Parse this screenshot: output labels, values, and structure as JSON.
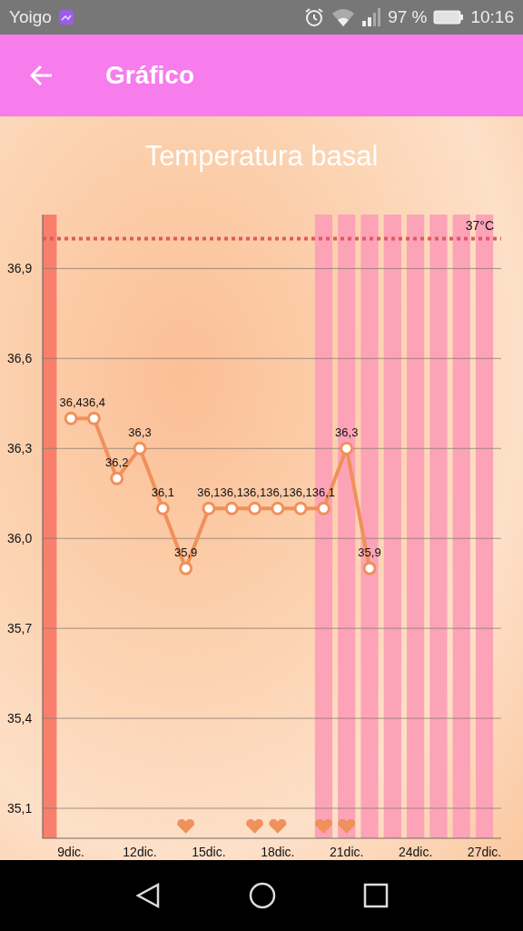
{
  "status_bar": {
    "carrier": "Yoigo",
    "battery": "97 %",
    "time": "10:16"
  },
  "app_bar": {
    "title": "Gráfico"
  },
  "chart_data": {
    "type": "line",
    "title": "Temperatura basal",
    "x": [
      9,
      10,
      11,
      12,
      13,
      14,
      15,
      16,
      17,
      18,
      19,
      20,
      21,
      22
    ],
    "series": [
      {
        "color": "#f0905a",
        "marker": "circle",
        "values": [
          36.4,
          36.4,
          36.2,
          36.3,
          36.1,
          35.9,
          36.1,
          36.1,
          36.1,
          36.1,
          36.1,
          36.1,
          36.3,
          35.9
        ]
      },
      {
        "type": "scatter",
        "color": "#f0905a",
        "values": [
          null,
          null,
          null,
          null,
          null,
          35.04,
          null,
          null,
          35.04,
          35.04,
          null,
          35.04,
          35.04,
          null
        ]
      }
    ],
    "value_labels": [
      "36,4",
      "36,4",
      "36,2",
      "36,3",
      "36,1",
      "35,9",
      "36,1",
      "36,1",
      "36,1",
      "36,1",
      "36,1",
      "36,1",
      "36,3",
      "35,9"
    ],
    "xlim": [
      7.77,
      27.73
    ],
    "ylim": [
      35.0,
      37.08
    ],
    "grid": true,
    "xticks": [
      {
        "value": 9,
        "label": "9dic."
      },
      {
        "value": 12,
        "label": "12dic."
      },
      {
        "value": 15,
        "label": "15dic."
      },
      {
        "value": 18,
        "label": "18dic."
      },
      {
        "value": 21,
        "label": "21dic."
      },
      {
        "value": 24,
        "label": "24dic."
      },
      {
        "value": 27,
        "label": "27dic."
      }
    ],
    "yticks": [
      {
        "value": 35.1,
        "label": "35,1"
      },
      {
        "value": 35.4,
        "label": "35,4"
      },
      {
        "value": 35.7,
        "label": "35,7"
      },
      {
        "value": 36.0,
        "label": "36,0"
      },
      {
        "value": 36.3,
        "label": "36,3"
      },
      {
        "value": 36.6,
        "label": "36,6"
      },
      {
        "value": 36.9,
        "label": "36,9"
      }
    ],
    "ref_lines": [
      {
        "axis": "y",
        "value": 37,
        "label": "37°C",
        "color": "#e05a60"
      }
    ],
    "bands": [
      {
        "axis": "x",
        "from": 7.62,
        "to": 8.38,
        "color": "#f77f6c"
      },
      {
        "axis": "x",
        "from": 19.62,
        "to": 20.38,
        "color": "#fca3b8"
      },
      {
        "axis": "x",
        "from": 20.62,
        "to": 21.38,
        "color": "#fca3b8"
      },
      {
        "axis": "x",
        "from": 21.62,
        "to": 22.38,
        "color": "#fca3b8"
      },
      {
        "axis": "x",
        "from": 22.62,
        "to": 23.38,
        "color": "#fca3b8"
      },
      {
        "axis": "x",
        "from": 23.62,
        "to": 24.38,
        "color": "#fca3b8"
      },
      {
        "axis": "x",
        "from": 24.62,
        "to": 25.38,
        "color": "#fca3b8"
      },
      {
        "axis": "x",
        "from": 25.62,
        "to": 26.38,
        "color": "#fca3b8"
      },
      {
        "axis": "x",
        "from": 26.62,
        "to": 27.38,
        "color": "#fca3b8"
      }
    ]
  }
}
